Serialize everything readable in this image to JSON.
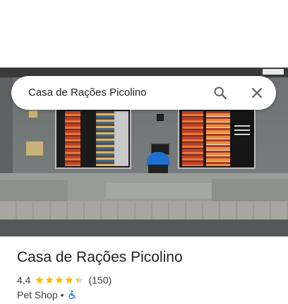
{
  "search": {
    "query": "Casa de Rações Picolino"
  },
  "place": {
    "name": "Casa de Rações Picolino",
    "rating": "4,4",
    "stars": 4.4,
    "review_count": "(150)",
    "category": "Pet Shop",
    "separator": "•"
  },
  "icons": {
    "search": "search-icon",
    "close": "close-icon",
    "accessibility": "wheelchair-accessible-icon",
    "star": "star-icon"
  },
  "colors": {
    "star": "#fbbc04",
    "accessibility": "#1a73e8",
    "doghouse": "#1f6fd1"
  }
}
